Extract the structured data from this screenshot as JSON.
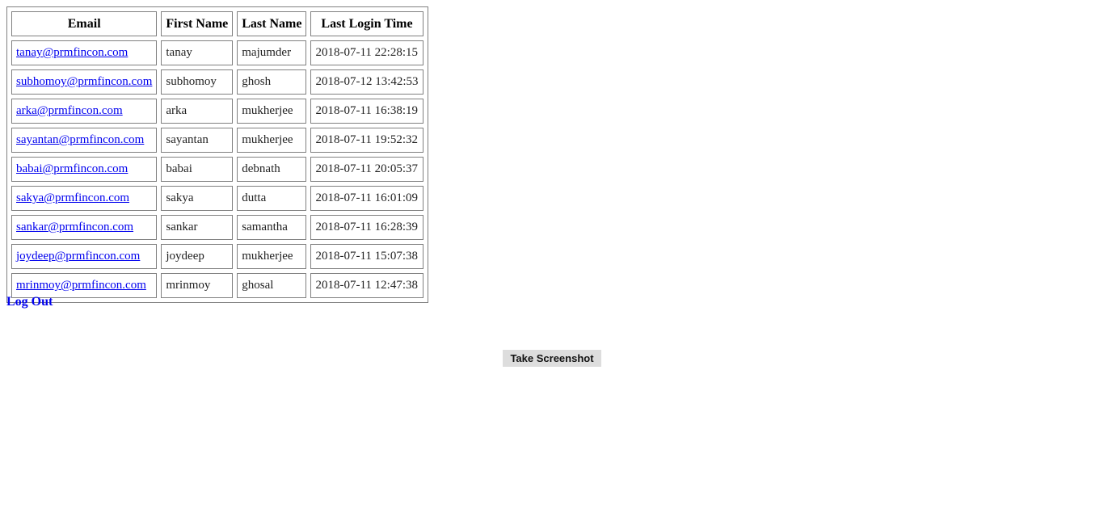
{
  "table": {
    "headers": [
      "Email",
      "First Name",
      "Last Name",
      "Last Login Time"
    ],
    "rows": [
      {
        "email": "tanay@prmfincon.com",
        "first_name": "tanay",
        "last_name": "majumder",
        "last_login": "2018-07-11 22:28:15"
      },
      {
        "email": "subhomoy@prmfincon.com",
        "first_name": "subhomoy",
        "last_name": "ghosh",
        "last_login": "2018-07-12 13:42:53"
      },
      {
        "email": "arka@prmfincon.com",
        "first_name": "arka",
        "last_name": "mukherjee",
        "last_login": "2018-07-11 16:38:19"
      },
      {
        "email": "sayantan@prmfincon.com",
        "first_name": "sayantan",
        "last_name": "mukherjee",
        "last_login": "2018-07-11 19:52:32"
      },
      {
        "email": "babai@prmfincon.com",
        "first_name": "babai",
        "last_name": "debnath",
        "last_login": "2018-07-11 20:05:37"
      },
      {
        "email": "sakya@prmfincon.com",
        "first_name": "sakya",
        "last_name": "dutta",
        "last_login": "2018-07-11 16:01:09"
      },
      {
        "email": "sankar@prmfincon.com",
        "first_name": "sankar",
        "last_name": "samantha",
        "last_login": "2018-07-11 16:28:39"
      },
      {
        "email": "joydeep@prmfincon.com",
        "first_name": "joydeep",
        "last_name": "mukherjee",
        "last_login": "2018-07-11 15:07:38"
      },
      {
        "email": "mrinmoy@prmfincon.com",
        "first_name": "mrinmoy",
        "last_name": "ghosal",
        "last_login": "2018-07-11 12:47:38"
      }
    ]
  },
  "logout_label": "Log Out",
  "screenshot_button_label": "Take Screenshot",
  "colors": {
    "link": "#0000ee",
    "border": "#808080",
    "button_bg": "#dddddd"
  }
}
